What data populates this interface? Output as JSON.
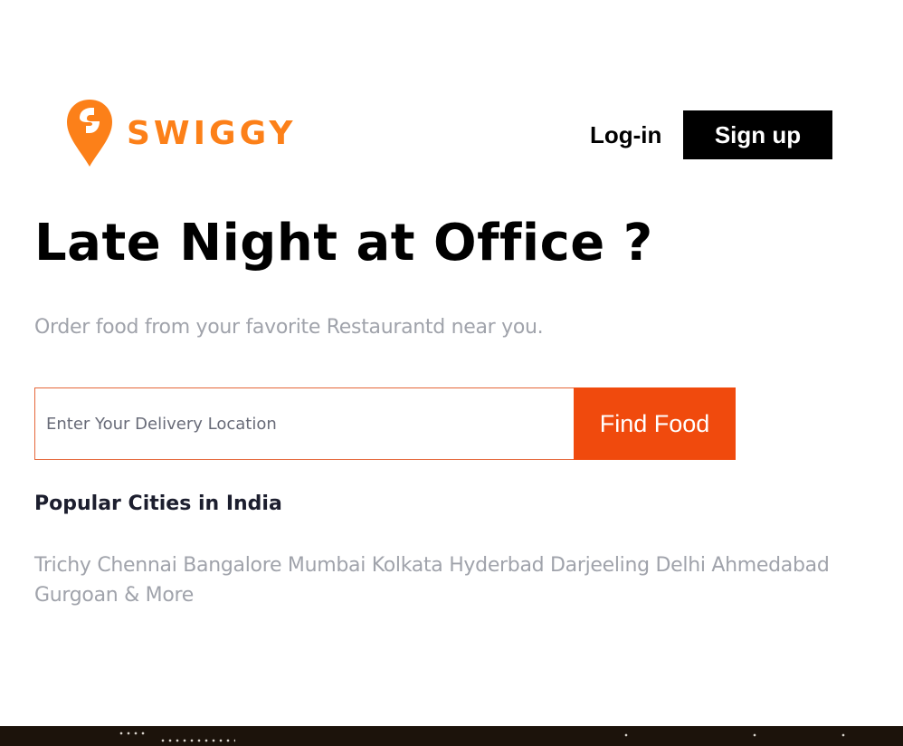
{
  "header": {
    "brand_name": "SWIGGY",
    "brand_color": "#fc8019",
    "logo_icon": "swiggy-pin-icon",
    "login_label": "Log-in",
    "signup_label": "Sign up"
  },
  "hero": {
    "title": "Late Night at Office ?",
    "subtitle": "Order food from your favorite Restaurantd near you."
  },
  "search": {
    "placeholder": "Enter Your Delivery Location",
    "value": "",
    "button_label": "Find Food",
    "button_color": "#f04a0d"
  },
  "popular": {
    "heading": "Popular Cities in India",
    "cities": [
      "Trichy",
      "Chennai",
      "Bangalore",
      "Mumbai",
      "Kolkata",
      "Hyderbad",
      "Darjeeling",
      "Delhi",
      "Ahmedabad",
      "Gurgoan & More"
    ]
  }
}
